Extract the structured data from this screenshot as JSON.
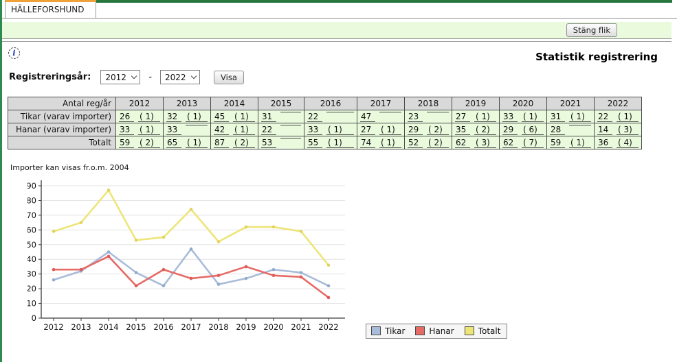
{
  "window": {
    "tab_label": "HÄLLEFORSHUND",
    "close_tab_label": "Stäng flik"
  },
  "header": {
    "title": "Statistik registrering"
  },
  "filter": {
    "label": "Registreringsår:",
    "from_year": "2012",
    "to_year": "2022",
    "range_separator": "-",
    "submit_label": "Visa"
  },
  "table": {
    "corner_label": "Antal reg/år",
    "years": [
      "2012",
      "2013",
      "2014",
      "2015",
      "2016",
      "2017",
      "2018",
      "2019",
      "2020",
      "2021",
      "2022"
    ],
    "rows": [
      {
        "label": "Tikar (varav importer)",
        "cells": [
          [
            "26",
            "( 1)"
          ],
          [
            "32",
            "( 1)"
          ],
          [
            "45",
            "( 1)"
          ],
          [
            "31",
            ""
          ],
          [
            "22",
            ""
          ],
          [
            "47",
            ""
          ],
          [
            "23",
            ""
          ],
          [
            "27",
            "( 1)"
          ],
          [
            "33",
            "( 1)"
          ],
          [
            "31",
            "( 1)"
          ],
          [
            "22",
            "( 1)"
          ]
        ]
      },
      {
        "label": "Hanar (varav importer)",
        "cells": [
          [
            "33",
            "( 1)"
          ],
          [
            "33",
            ""
          ],
          [
            "42",
            "( 1)"
          ],
          [
            "22",
            ""
          ],
          [
            "33",
            "( 1)"
          ],
          [
            "27",
            "( 1)"
          ],
          [
            "29",
            "( 2)"
          ],
          [
            "35",
            "( 2)"
          ],
          [
            "29",
            "( 6)"
          ],
          [
            "28",
            ""
          ],
          [
            "14",
            "( 3)"
          ]
        ]
      },
      {
        "label": "Totalt",
        "cells": [
          [
            "59",
            "( 2)"
          ],
          [
            "65",
            "( 1)"
          ],
          [
            "87",
            "( 2)"
          ],
          [
            "53",
            ""
          ],
          [
            "55",
            "( 1)"
          ],
          [
            "74",
            "( 1)"
          ],
          [
            "52",
            "( 2)"
          ],
          [
            "62",
            "( 3)"
          ],
          [
            "62",
            "( 7)"
          ],
          [
            "59",
            "( 1)"
          ],
          [
            "36",
            "( 4)"
          ]
        ]
      }
    ]
  },
  "note": "Importer kan visas fr.o.m. 2004",
  "chart_data": {
    "type": "line",
    "x": [
      "2012",
      "2013",
      "2014",
      "2015",
      "2016",
      "2017",
      "2018",
      "2019",
      "2020",
      "2021",
      "2022"
    ],
    "series": [
      {
        "name": "Tikar",
        "color": "#a9bcd9",
        "marker_color": "#92abce",
        "values": [
          26,
          32,
          45,
          31,
          22,
          47,
          23,
          27,
          33,
          31,
          22
        ]
      },
      {
        "name": "Hanar",
        "color": "#e66a66",
        "marker_color": "#de5a58",
        "values": [
          33,
          33,
          42,
          22,
          33,
          27,
          29,
          35,
          29,
          28,
          14
        ]
      },
      {
        "name": "Totalt",
        "color": "#ede578",
        "marker_color": "#e2d35e",
        "values": [
          59,
          65,
          87,
          53,
          55,
          74,
          52,
          62,
          62,
          59,
          36
        ]
      }
    ],
    "ylim": [
      0,
      90
    ],
    "ytick_step": 10,
    "grid": "horizontal",
    "legend_position": "bottom-left",
    "axis_color": "#3a3a3a",
    "grid_color": "#e4e4e6"
  },
  "theme": {
    "frame_green": "#2f8a4f",
    "top_bar_green": "#26763d",
    "tab_accent_orange": "#efa23a",
    "panel_green": "#eafadd",
    "table_header_gray": "#d9d9d9"
  }
}
